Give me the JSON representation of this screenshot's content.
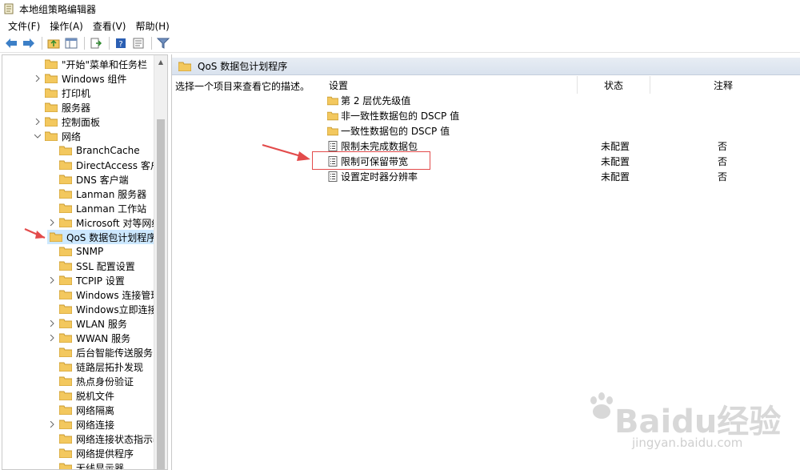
{
  "window": {
    "title": "本地组策略编辑器"
  },
  "menu": [
    "文件(F)",
    "操作(A)",
    "查看(V)",
    "帮助(H)"
  ],
  "toolbar": [
    "back-icon",
    "forward-icon",
    "up-folder-icon",
    "show-hide-tree-icon",
    "export-list-icon",
    "help-icon",
    "properties-icon",
    "filter-icon"
  ],
  "tree": {
    "items": [
      {
        "label": "\"开始\"菜单和任务栏",
        "expander": false
      },
      {
        "label": "Windows 组件",
        "expander": "collapsed"
      },
      {
        "label": "打印机",
        "expander": false
      },
      {
        "label": "服务器",
        "expander": false
      },
      {
        "label": "控制面板",
        "expander": "collapsed"
      },
      {
        "label": "网络",
        "expander": "expanded"
      },
      {
        "label": "BranchCache",
        "expander": false
      },
      {
        "label": "DirectAccess 客户端",
        "expander": false
      },
      {
        "label": "DNS 客户端",
        "expander": false
      },
      {
        "label": "Lanman 服务器",
        "expander": false
      },
      {
        "label": "Lanman 工作站",
        "expander": false
      },
      {
        "label": "Microsoft 对等网络服",
        "expander": "collapsed"
      },
      {
        "label": "QoS 数据包计划程序",
        "expander": false,
        "selected": true
      },
      {
        "label": "SNMP",
        "expander": false
      },
      {
        "label": "SSL 配置设置",
        "expander": false
      },
      {
        "label": "TCPIP 设置",
        "expander": "collapsed"
      },
      {
        "label": "Windows 连接管理器",
        "expander": false
      },
      {
        "label": "Windows立即连接",
        "expander": false
      },
      {
        "label": "WLAN 服务",
        "expander": "collapsed"
      },
      {
        "label": "WWAN 服务",
        "expander": "collapsed"
      },
      {
        "label": "后台智能传送服务(BI",
        "expander": false
      },
      {
        "label": "链路层拓扑发现",
        "expander": false
      },
      {
        "label": "热点身份验证",
        "expander": false
      },
      {
        "label": "脱机文件",
        "expander": false
      },
      {
        "label": "网络隔离",
        "expander": false
      },
      {
        "label": "网络连接",
        "expander": "collapsed"
      },
      {
        "label": "网络连接状态指示器",
        "expander": false
      },
      {
        "label": "网络提供程序",
        "expander": false
      },
      {
        "label": "无线显示器",
        "expander": false
      }
    ]
  },
  "panel": {
    "header": "QoS 数据包计划程序",
    "description": "选择一个项目来查看它的描述。",
    "columns": {
      "setting": "设置",
      "state": "状态",
      "comment": "注释"
    },
    "rows": [
      {
        "type": "folder",
        "name": "第 2 层优先级值",
        "state": "",
        "comment": ""
      },
      {
        "type": "folder",
        "name": "非一致性数据包的 DSCP 值",
        "state": "",
        "comment": ""
      },
      {
        "type": "folder",
        "name": "一致性数据包的 DSCP 值",
        "state": "",
        "comment": ""
      },
      {
        "type": "policy",
        "name": "限制未完成数据包",
        "state": "未配置",
        "comment": "否"
      },
      {
        "type": "policy",
        "name": "限制可保留带宽",
        "state": "未配置",
        "comment": "否"
      },
      {
        "type": "policy",
        "name": "设置定时器分辨率",
        "state": "未配置",
        "comment": "否"
      }
    ]
  },
  "watermark": {
    "brand": "Baidu经验",
    "url": "jingyan.baidu.com"
  },
  "colors": {
    "annotation_red": "#e34b4b",
    "selection": "#cce8ff",
    "folder": "#f3c85e"
  }
}
